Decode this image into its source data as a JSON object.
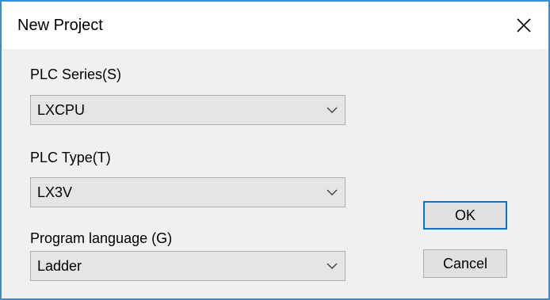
{
  "window": {
    "title": "New Project"
  },
  "fields": {
    "plc_series": {
      "label": "PLC Series(S)",
      "value": "LXCPU"
    },
    "plc_type": {
      "label": "PLC Type(T)",
      "value": "LX3V"
    },
    "program_language": {
      "label": "Program language (G)",
      "value": "Ladder"
    }
  },
  "buttons": {
    "ok_label": "OK",
    "cancel_label": "Cancel"
  },
  "icons": {
    "close": "close-icon",
    "dropdown": "chevron-down-icon"
  },
  "colors": {
    "window_border": "#3b8bd3",
    "default_button_border": "#0078d7"
  }
}
